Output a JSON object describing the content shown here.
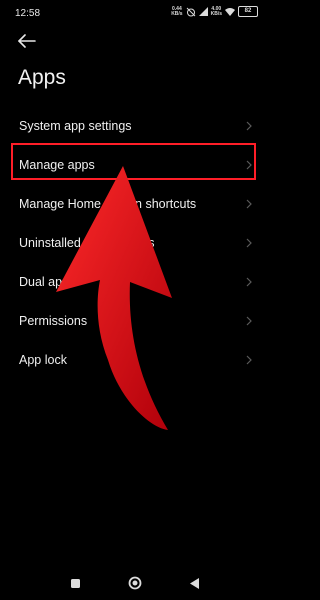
{
  "status_bar": {
    "time": "12:58",
    "net_speed_1": "0.44",
    "net_speed_1_unit": "KB/s",
    "net_speed_2": "4.00",
    "net_speed_2_unit": "KB/s",
    "battery": "82"
  },
  "header": {
    "title": "Apps"
  },
  "menu": {
    "items": [
      {
        "label": "System app settings"
      },
      {
        "label": "Manage apps"
      },
      {
        "label": "Manage Home screen shortcuts"
      },
      {
        "label": "Uninstalled system apps"
      },
      {
        "label": "Dual apps"
      },
      {
        "label": "Permissions"
      },
      {
        "label": "App lock"
      }
    ]
  },
  "highlight_color": "#ff1e28",
  "arrow_color": "#e0101a",
  "icons": {
    "back": "arrow-left-icon",
    "chevron": "chevron-right-icon",
    "nav_recents": "square-icon",
    "nav_home": "circle-icon",
    "nav_back": "triangle-back-icon"
  }
}
